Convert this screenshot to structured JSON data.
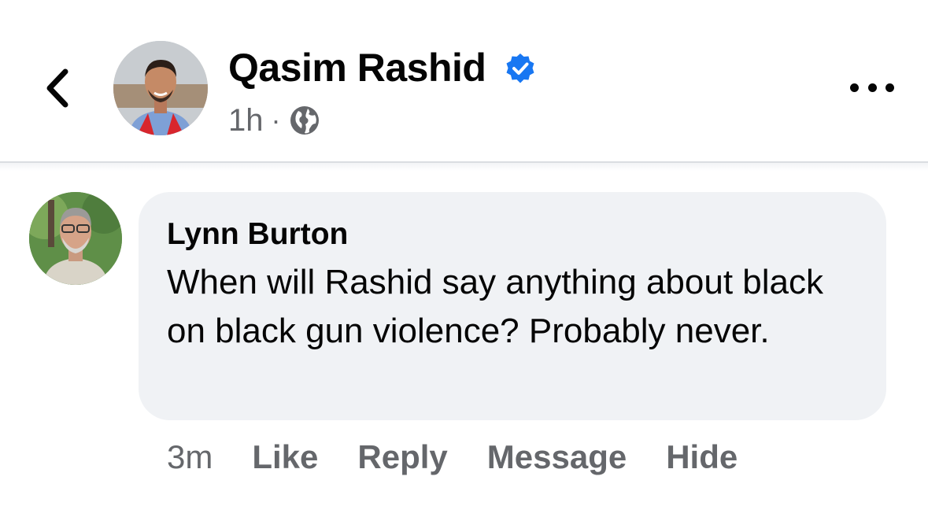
{
  "header": {
    "back_icon": "chevron-left-icon",
    "author_name": "Qasim Rashid",
    "verified_icon": "verified-badge-icon",
    "verified_color": "#1877f2",
    "time": "1h",
    "separator": "·",
    "audience_icon": "globe-icon",
    "more_icon": "more-horizontal-icon"
  },
  "comment": {
    "author": "Lynn Burton",
    "text": "When will Rashid say anything about black on black gun violence? Probably never.",
    "bubble_color": "#f0f2f5",
    "time": "3m",
    "actions": [
      "Like",
      "Reply",
      "Message",
      "Hide"
    ]
  }
}
